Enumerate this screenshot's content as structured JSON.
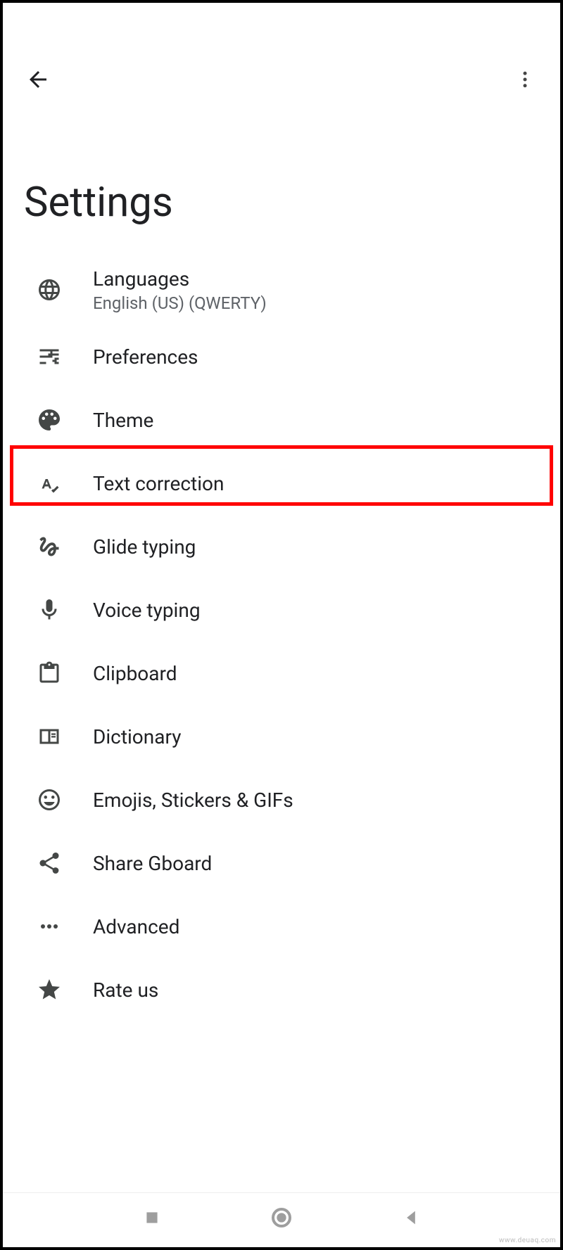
{
  "header": {
    "title": "Settings"
  },
  "items": [
    {
      "label": "Languages",
      "sub": "English (US) (QWERTY)",
      "icon": "globe-icon",
      "highlighted": false
    },
    {
      "label": "Preferences",
      "sub": "",
      "icon": "sliders-icon",
      "highlighted": false
    },
    {
      "label": "Theme",
      "sub": "",
      "icon": "palette-icon",
      "highlighted": false
    },
    {
      "label": "Text correction",
      "sub": "",
      "icon": "text-correction-icon",
      "highlighted": true
    },
    {
      "label": "Glide typing",
      "sub": "",
      "icon": "gesture-icon",
      "highlighted": false
    },
    {
      "label": "Voice typing",
      "sub": "",
      "icon": "mic-icon",
      "highlighted": false
    },
    {
      "label": "Clipboard",
      "sub": "",
      "icon": "clipboard-icon",
      "highlighted": false
    },
    {
      "label": "Dictionary",
      "sub": "",
      "icon": "book-icon",
      "highlighted": false
    },
    {
      "label": "Emojis, Stickers & GIFs",
      "sub": "",
      "icon": "emoji-icon",
      "highlighted": false
    },
    {
      "label": "Share Gboard",
      "sub": "",
      "icon": "share-icon",
      "highlighted": false
    },
    {
      "label": "Advanced",
      "sub": "",
      "icon": "dots-icon",
      "highlighted": false
    },
    {
      "label": "Rate us",
      "sub": "",
      "icon": "star-icon",
      "highlighted": false
    }
  ],
  "watermark": "www.deuaq.com"
}
